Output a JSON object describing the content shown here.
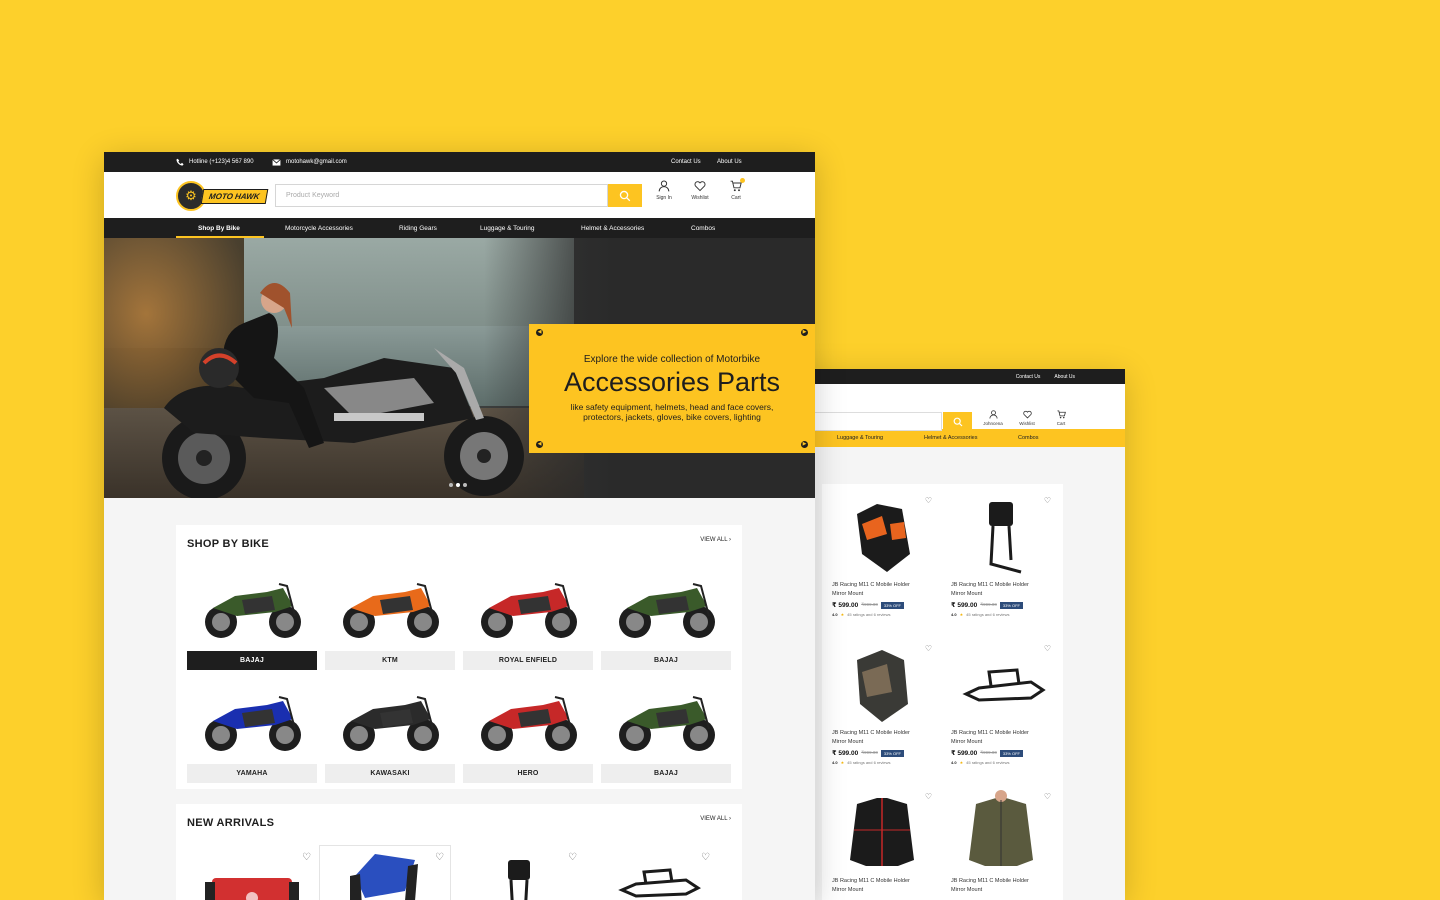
{
  "colors": {
    "accent": "#fdc421",
    "dark": "#1e1e1e",
    "background": "#fdd02b",
    "discount_badge": "#2d4c7a"
  },
  "front": {
    "topbar": {
      "hotline": "Hotline (+123)4 567 890",
      "email": "motohawk@gmail.com",
      "contact": "Contact Us",
      "about": "About Us"
    },
    "brand": {
      "logo_text": "MOTO HAWK"
    },
    "search": {
      "placeholder": "Product Keyword"
    },
    "header_icons": {
      "signin": "Sign In",
      "wishlist": "Wishlist",
      "cart": "Cart"
    },
    "nav": [
      "Shop By Bike",
      "Motorcycle Accessories",
      "Riding Gears",
      "Luggage & Touring",
      "Helmet & Accessories",
      "Combos"
    ],
    "hero": {
      "eyebrow": "Explore the wide collection of Motorbike",
      "headline": "Accessories Parts",
      "sub": "like safety equipment, helmets, head and face covers, protectors, jackets, gloves, bike covers, lighting",
      "slides": 3,
      "active_slide": 1
    },
    "shop_by_bike": {
      "title": "SHOP BY BIKE",
      "view_all": "VIEW ALL",
      "bikes": [
        {
          "name": "BAJAJ",
          "color": "#3a5a2a",
          "selected": true
        },
        {
          "name": "KTM",
          "color": "#e86a1a",
          "selected": false
        },
        {
          "name": "ROYAL ENFIELD",
          "color": "#c62828",
          "selected": false
        },
        {
          "name": "BAJAJ",
          "color": "#3a5a2a",
          "selected": false
        },
        {
          "name": "YAMAHA",
          "color": "#1a2fb0",
          "selected": false
        },
        {
          "name": "KAWASAKI",
          "color": "#2b2b2b",
          "selected": false
        },
        {
          "name": "HERO",
          "color": "#c62828",
          "selected": false
        },
        {
          "name": "BAJAJ",
          "color": "#3a5a2a",
          "selected": false
        }
      ]
    },
    "new_arrivals": {
      "title": "NEW ARRIVALS",
      "view_all": "VIEW ALL"
    }
  },
  "back": {
    "topbar": {
      "contact": "Contact Us",
      "about": "About Us"
    },
    "header_icons": {
      "user": "Johncena",
      "wishlist": "Wishlist",
      "cart": "Cart"
    },
    "nav": [
      "Luggage & Touring",
      "Helmet & Accessories",
      "Combos"
    ],
    "products": [
      {
        "title": "JB Racing M11 C Mobile Holder Mirror Mount",
        "price": "₹ 599.00",
        "mrp": "₹999.00",
        "off": "33% OFF",
        "rating": "4.0",
        "reviews": "45 ratings and 6 reviews",
        "kind": "gloves"
      },
      {
        "title": "JB Racing M11 C Mobile Holder Mirror Mount",
        "price": "₹ 599.00",
        "mrp": "₹999.00",
        "off": "33% OFF",
        "rating": "4.0",
        "reviews": "45 ratings and 6 reviews",
        "kind": "backrest"
      },
      {
        "title": "JB Racing M11 C Mobile Holder Mirror Mount",
        "price": "₹ 599.00",
        "mrp": "₹999.00",
        "off": "33% OFF",
        "rating": "4.0",
        "reviews": "45 ratings and 6 reviews",
        "kind": "gloves2"
      },
      {
        "title": "JB Racing M11 C Mobile Holder Mirror Mount",
        "price": "₹ 599.00",
        "mrp": "₹999.00",
        "off": "33% OFF",
        "rating": "4.0",
        "reviews": "45 ratings and 6 reviews",
        "kind": "rack"
      },
      {
        "title": "JB Racing M11 C Mobile Holder Mirror Mount",
        "price": "",
        "mrp": "",
        "off": "",
        "rating": "",
        "reviews": "",
        "kind": "jacket"
      },
      {
        "title": "JB Racing M11 C Mobile Holder Mirror Mount",
        "price": "",
        "mrp": "",
        "off": "",
        "rating": "",
        "reviews": "",
        "kind": "jacket2"
      }
    ]
  }
}
